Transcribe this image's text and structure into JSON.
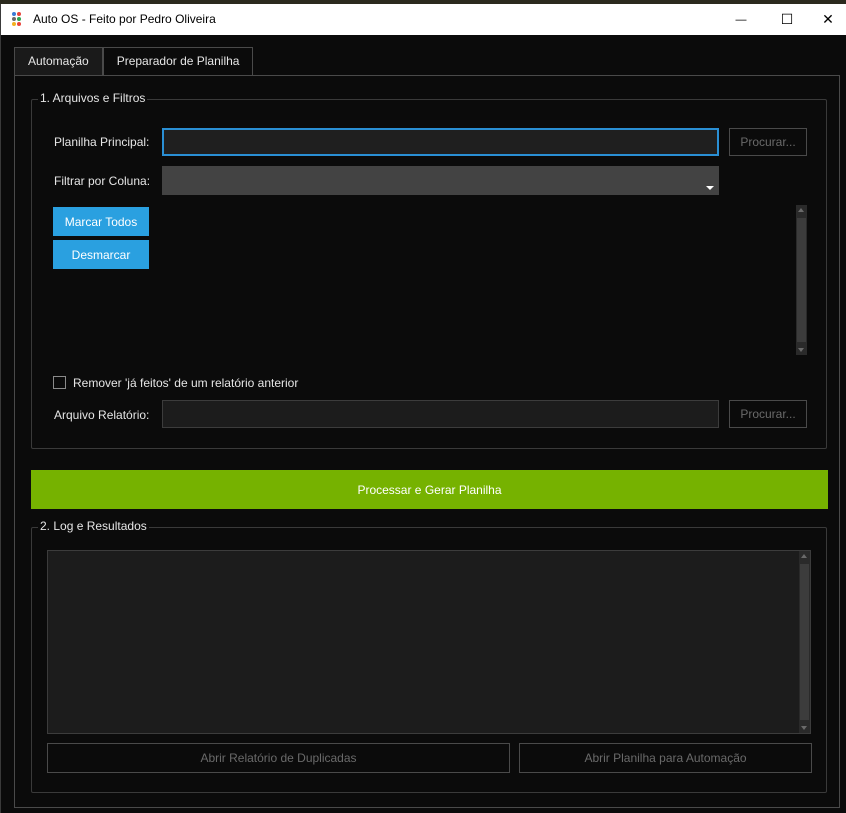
{
  "window": {
    "title": "Auto OS - Feito por Pedro Oliveira",
    "minimize_glyph": "—",
    "maximize_glyph": "☐",
    "close_glyph": "✕",
    "icon_colors": [
      "#3a7bd5",
      "#e8443a",
      "#6a6a6a",
      "#2ea44f",
      "#f2b01e",
      "#e8443a"
    ]
  },
  "tabs": [
    {
      "label": "Automação",
      "active": false
    },
    {
      "label": "Preparador de Planilha",
      "active": true
    }
  ],
  "files_group": {
    "title": "1. Arquivos e Filtros",
    "main_sheet_label": "Planilha Principal:",
    "main_sheet_value": "",
    "browse_label": "Procurar...",
    "filter_label": "Filtrar por Coluna:",
    "filter_value": "",
    "select_all_label": "Marcar Todos",
    "deselect_label": "Desmarcar",
    "remove_done_label": "Remover 'já feitos' de um relatório anterior",
    "remove_done_checked": false,
    "report_file_label": "Arquivo Relatório:",
    "report_file_value": "",
    "report_browse_label": "Procurar..."
  },
  "process_button_label": "Processar e Gerar Planilha",
  "log_group": {
    "title": "2. Log e Resultados",
    "log_text": "",
    "open_duplicates_label": "Abrir Relatório de Duplicadas",
    "open_automation_sheet_label": "Abrir Planilha para Automação"
  },
  "colors": {
    "accent_blue": "#2aa0e0",
    "process_green": "#76b200",
    "focus_border": "#2a8fd4",
    "background": "#0b0b0b"
  }
}
